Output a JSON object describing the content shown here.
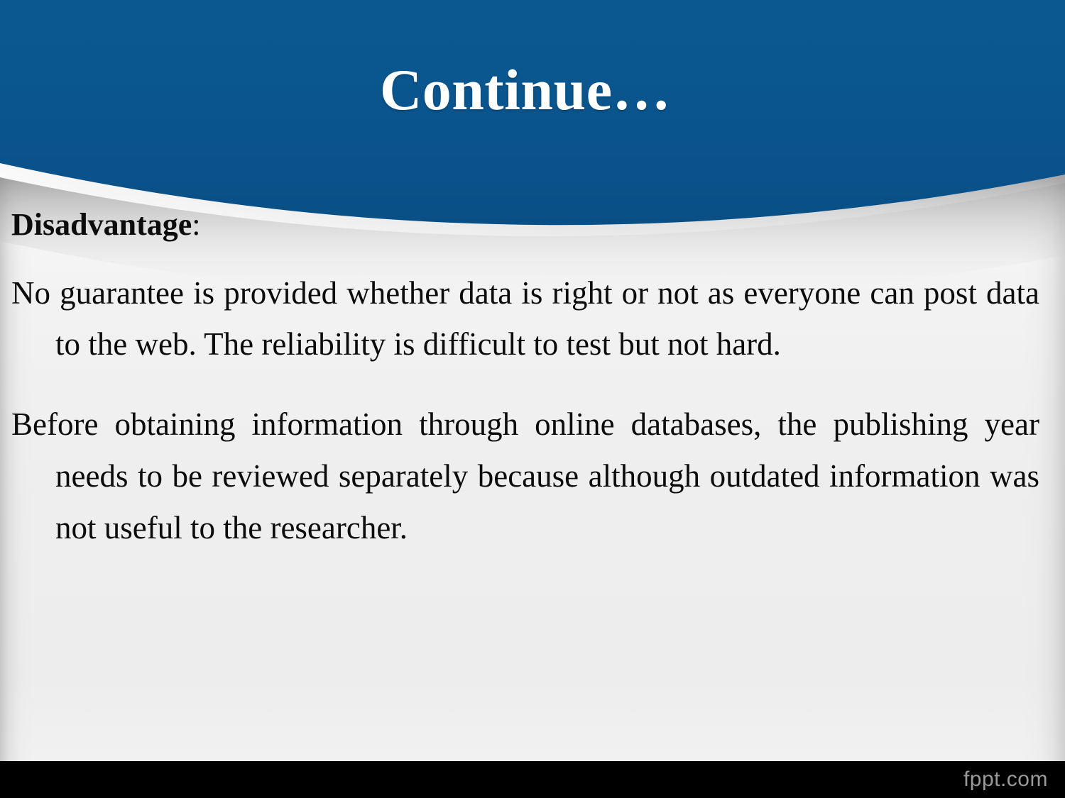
{
  "slide": {
    "title": "Continue…",
    "heading": {
      "label": "Disadvantage",
      "colon": ":"
    },
    "paragraphs": [
      "No guarantee is provided whether data is right or not as everyone can post data to the web. The reliability is difficult to test but not hard.",
      "Before obtaining information through online databases, the publishing year needs to be reviewed separately because although outdated information was not useful to the researcher."
    ]
  },
  "footer": {
    "watermark": "fppt.com"
  },
  "colors": {
    "banner_blue": "#0a548c",
    "body_gray": "#efefef",
    "footer_black": "#000000",
    "title_white": "#ffffff",
    "text_black": "#0c0c0c",
    "watermark_gray": "#9a9a9a"
  }
}
